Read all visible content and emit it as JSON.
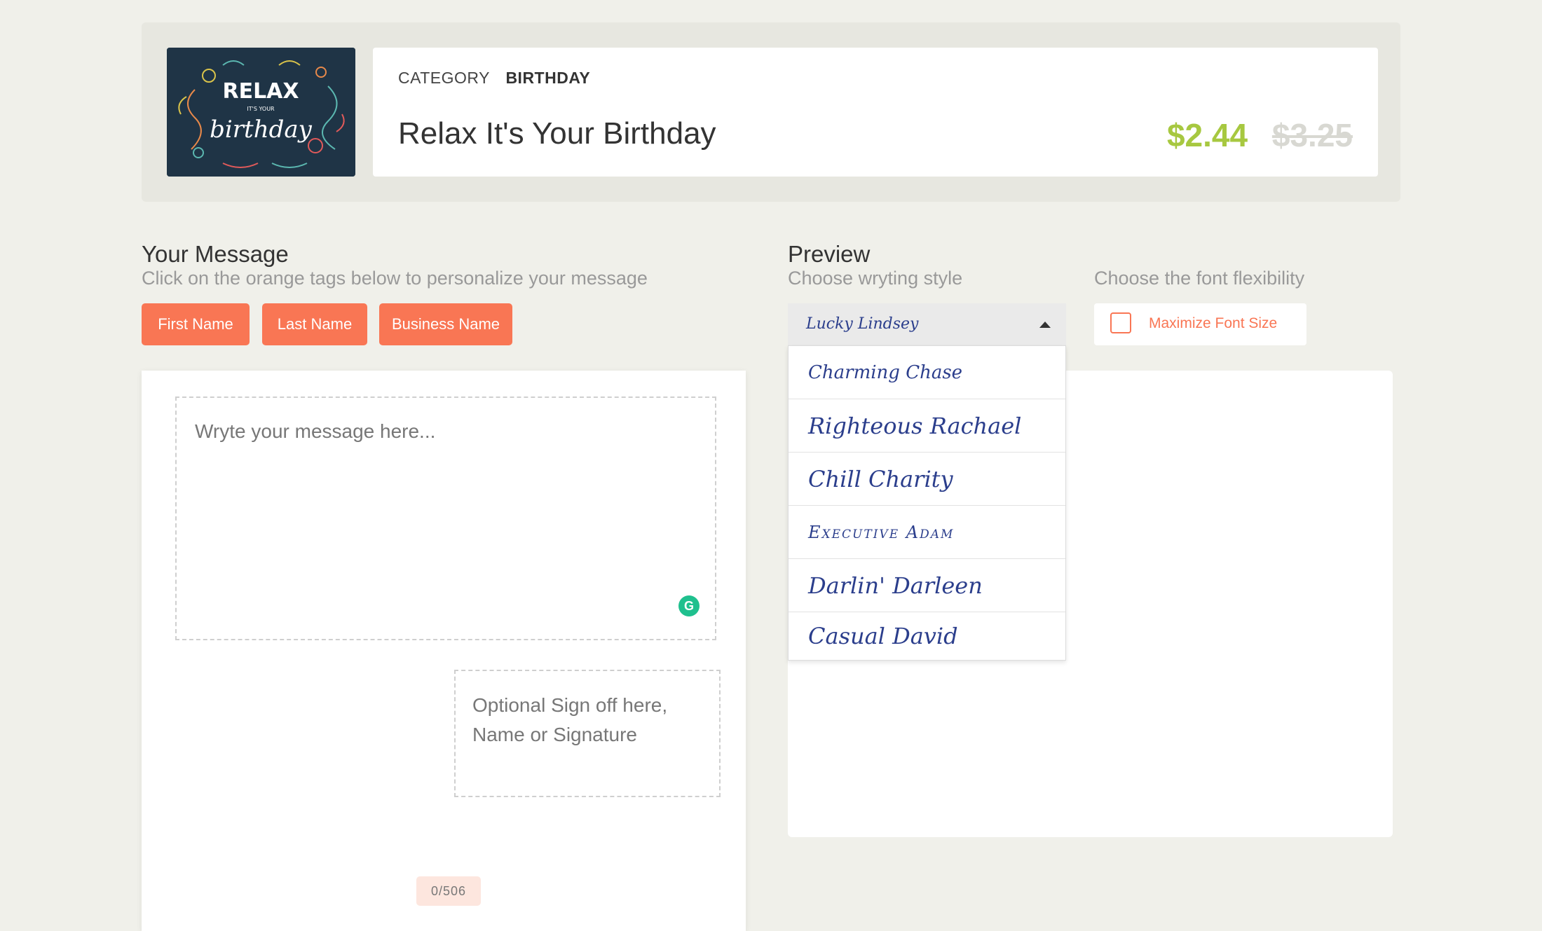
{
  "product": {
    "category_label": "CATEGORY",
    "category_value": "BIRTHDAY",
    "title": "Relax It's Your Birthday",
    "price_current": "$2.44",
    "price_original": "$3.25",
    "thumbnail": {
      "text_line1": "RELAX",
      "text_line2": "IT'S YOUR",
      "text_line3": "birthday"
    }
  },
  "message_section": {
    "title": "Your Message",
    "subtitle": "Click on the orange tags below to personalize your message",
    "tags": [
      "First Name",
      "Last Name",
      "Business Name"
    ],
    "message_placeholder": "Wryte your message here...",
    "signoff_line1": "Optional Sign off here,",
    "signoff_line2": "Name or Signature",
    "char_count": "0/506",
    "grammarly_icon": "G"
  },
  "preview_section": {
    "title": "Preview",
    "style_label": "Choose wryting style",
    "selected_style": "Lucky Lindsey",
    "style_options": [
      "Charming Chase",
      "Righteous Rachael",
      "Chill Charity",
      "Executive Adam",
      "Darlin' Darleen",
      "Casual David"
    ],
    "flex_label": "Choose the font flexibility",
    "maximize_label": "Maximize Font Size"
  },
  "colors": {
    "accent_orange": "#f97654",
    "price_green": "#a7c840",
    "handwriting_blue": "#2b3e8c"
  }
}
